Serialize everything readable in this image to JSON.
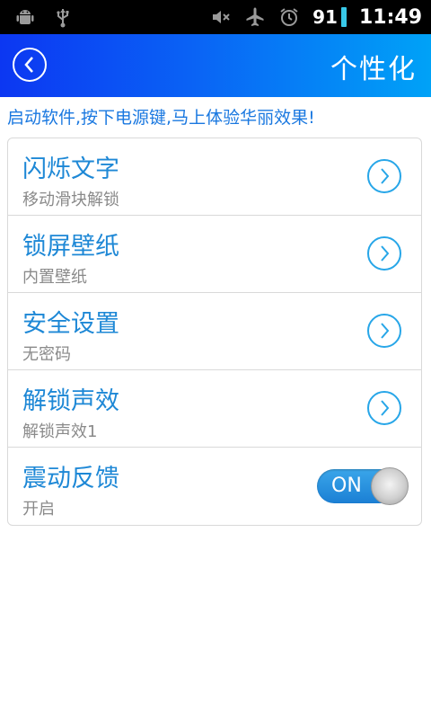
{
  "status_bar": {
    "icons": [
      "android-icon",
      "usb-icon",
      "mute-icon",
      "airplane-icon",
      "alarm-icon"
    ],
    "battery": "91",
    "time": "11:49"
  },
  "header": {
    "title": "个性化",
    "back_icon": "chevron-left-icon"
  },
  "tip": "启动软件,按下电源键,马上体验华丽效果!",
  "settings": [
    {
      "title": "闪烁文字",
      "subtitle": "移动滑块解锁",
      "control": "chevron"
    },
    {
      "title": "锁屏壁纸",
      "subtitle": "内置壁纸",
      "control": "chevron"
    },
    {
      "title": "安全设置",
      "subtitle": "无密码",
      "control": "chevron"
    },
    {
      "title": "解锁声效",
      "subtitle": "解锁声效1",
      "control": "chevron"
    },
    {
      "title": "震动反馈",
      "subtitle": "开启",
      "control": "toggle",
      "toggle_label": "ON",
      "toggle_on": true
    }
  ],
  "colors": {
    "accent": "#1e88d6",
    "header_start": "#0c37f2",
    "header_end": "#00a2f7"
  }
}
